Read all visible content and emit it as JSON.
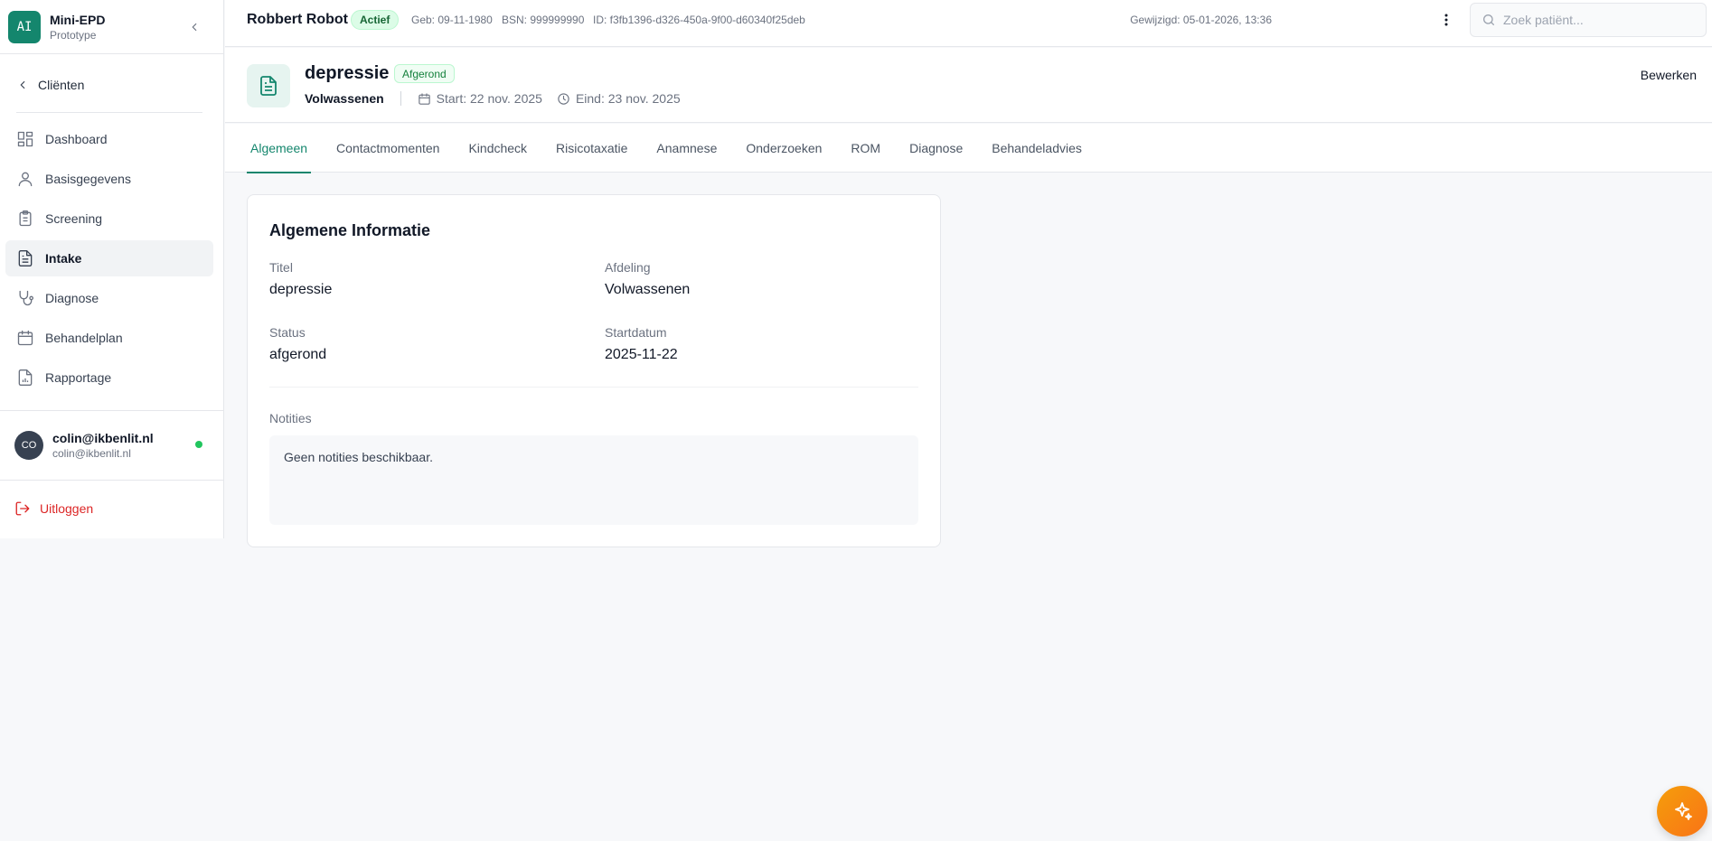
{
  "brand": {
    "logo": "AI",
    "name": "Mini-EPD",
    "subtitle": "Prototype"
  },
  "sidebar": {
    "back_label": "Cliënten",
    "items": [
      {
        "label": "Dashboard",
        "icon": "dashboard-icon"
      },
      {
        "label": "Basisgegevens",
        "icon": "user-icon"
      },
      {
        "label": "Screening",
        "icon": "clipboard-icon"
      },
      {
        "label": "Intake",
        "icon": "document-icon",
        "active": true
      },
      {
        "label": "Diagnose",
        "icon": "stethoscope-icon"
      },
      {
        "label": "Behandelplan",
        "icon": "calendar-icon"
      },
      {
        "label": "Rapportage",
        "icon": "report-icon"
      }
    ],
    "user": {
      "initials": "CO",
      "name": "colin@ikbenlit.nl",
      "email": "colin@ikbenlit.nl"
    },
    "logout_label": "Uitloggen"
  },
  "topbar": {
    "patient_name": "Robbert Robot",
    "status_badge": "Actief",
    "dob": "Geb: 09-11-1980",
    "bsn": "BSN: 999999990",
    "id": "ID: f3fb1396-d326-450a-9f00-d60340f25deb",
    "modified": "Gewijzigd: 05-01-2026, 13:36",
    "search_placeholder": "Zoek patiënt..."
  },
  "header": {
    "title": "depressie",
    "badge": "Afgerond",
    "department": "Volwassenen",
    "start": "Start: 22 nov. 2025",
    "end": "Eind: 23 nov. 2025",
    "edit_label": "Bewerken"
  },
  "tabs": [
    {
      "label": "Algemeen",
      "active": true
    },
    {
      "label": "Contactmomenten"
    },
    {
      "label": "Kindcheck"
    },
    {
      "label": "Risicotaxatie"
    },
    {
      "label": "Anamnese"
    },
    {
      "label": "Onderzoeken"
    },
    {
      "label": "ROM"
    },
    {
      "label": "Diagnose"
    },
    {
      "label": "Behandeladvies"
    }
  ],
  "info": {
    "title": "Algemene Informatie",
    "fields": {
      "titel": {
        "label": "Titel",
        "value": "depressie"
      },
      "afdeling": {
        "label": "Afdeling",
        "value": "Volwassenen"
      },
      "status": {
        "label": "Status",
        "value": "afgerond"
      },
      "startdatum": {
        "label": "Startdatum",
        "value": "2025-11-22"
      }
    },
    "notes_label": "Notities",
    "notes_text": "Geen notities beschikbaar."
  },
  "colors": {
    "accent": "#14866d",
    "danger": "#dc2626",
    "fab": "#f59e0b"
  }
}
